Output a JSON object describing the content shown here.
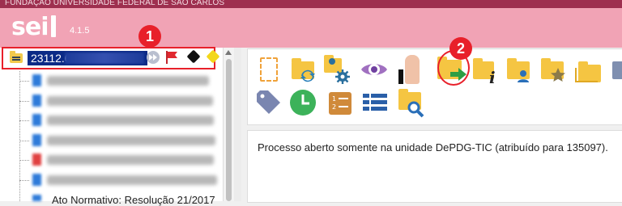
{
  "institution": "FUNDAÇÃO UNIVERSIDADE FEDERAL DE SÃO CARLOS",
  "app": {
    "logo": "sei",
    "version": "4.1.5"
  },
  "markers": {
    "one": "1",
    "two": "2"
  },
  "process": {
    "number": "23112.0"
  },
  "tree": {
    "last_item": "Ato Normativo: Resolução 21/2017"
  },
  "content": {
    "message": "Processo aberto somente na unidade DePDG-TIC (atribuído para 135097)."
  },
  "colors": {
    "top_bar": "#9e2f4f",
    "header": "#f1a3b5",
    "marker": "#e8202a",
    "selection": "#0b2a86"
  },
  "toolbar_icons": [
    "new-document-icon",
    "reopen-process-icon",
    "assign-process-icon",
    "view-icon",
    "sign-icon",
    "send-process-icon",
    "process-info-icon",
    "assigned-user-icon",
    "favorite-icon",
    "folders-icon",
    "tag-icon",
    "clock-icon",
    "list-numbered-icon",
    "list-icon",
    "search-folder-icon"
  ]
}
